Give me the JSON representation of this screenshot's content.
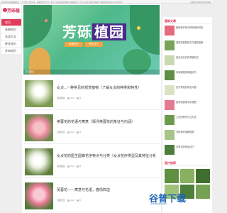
{
  "topbar": {
    "left_text": "欢迎来到芳砾植园网站，一个汇聚了丰富多彩、种植知识的平台。致力于分享各类植物养护与种植知识，让每一位园艺爱好者轻松学习植物的养护技巧与花卉知识！",
    "right_text": "如果我们的网站对你有帮助"
  },
  "logo": {
    "text": "芳砾植"
  },
  "sidebar": {
    "items": [
      {
        "label": "首页"
      },
      {
        "label": "养殖知识"
      },
      {
        "label": "花语大全"
      },
      {
        "label": "种花知识"
      },
      {
        "label": "多肉知识"
      }
    ]
  },
  "banner": {
    "title_a": "芳砾",
    "title_b": "植园",
    "pill_1": "种植知识",
    "pill_2": "养花技巧",
    "caption": "花卉知识"
  },
  "articles": [
    {
      "title": "女贞...一种常见的观赏植物（了解女贞的种类和特性）",
      "tag": "种花知识",
      "date": "2024",
      "views": "次"
    },
    {
      "title": "英蓉花的花语与寓意（探寻英蓉花的象征与内涵）",
      "tag": "花语大全",
      "date": "2024",
      "views": "次"
    },
    {
      "title": "女贞花的医生圆锥花序特点与分类（女贞花序类型及其特征分析）",
      "tag": "种花知识",
      "date": "2024",
      "views": "次"
    },
    {
      "title": "芙蓉花——寓意与花语，春情四溢",
      "tag": "花语大全",
      "date": "2024",
      "views": "次"
    }
  ],
  "right": {
    "head_1": "最新文章",
    "latest": [
      {
        "text": "植物养护知识的种类和特性"
      },
      {
        "text": "观赏性植物的花与观赏植物"
      },
      {
        "text": "用白色花卉的养殖知识"
      },
      {
        "text": "多肉植物的种植技巧"
      },
      {
        "text": "花卉养殖的常见问题"
      },
      {
        "text": "如何给植物浇水施肥"
      },
      {
        "text": "兰花的养护方法大全"
      },
      {
        "text": "怎样养好绿萝植物"
      },
      {
        "text": "月季花的修剪技巧"
      }
    ],
    "head_2": "图片推荐"
  },
  "watermark": {
    "text": "谷普下载",
    "sub": "GUPUXIAZAI.COM"
  },
  "colors": {
    "accent": "#e23b5b",
    "banner_green": "#4fb98a",
    "tag_orange": "#f4a340"
  }
}
